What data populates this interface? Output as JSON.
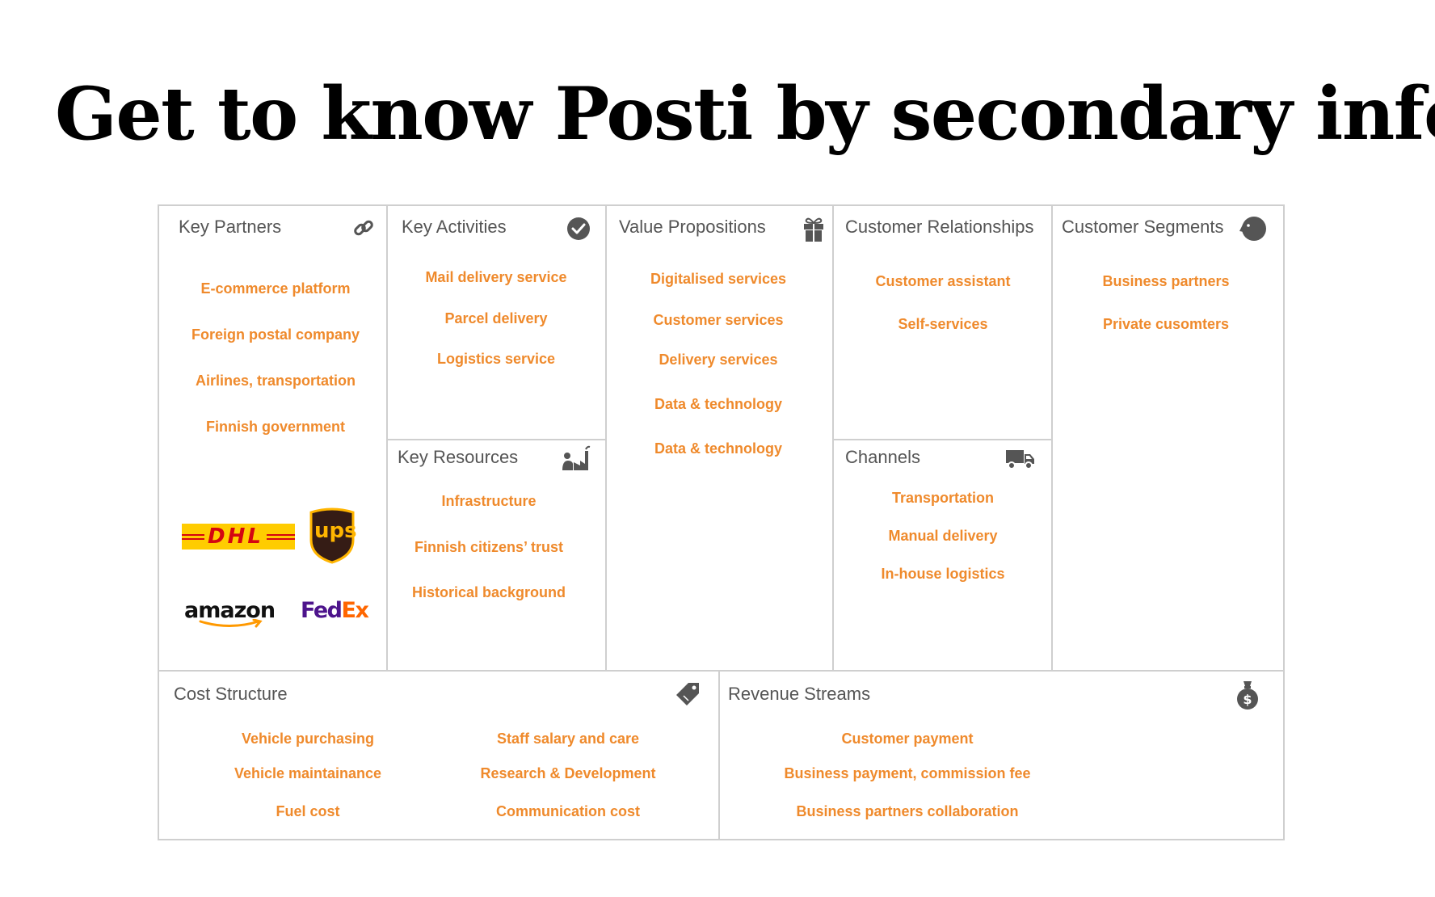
{
  "title": "Get to know Posti by secondary info",
  "colors": {
    "accent": "#ef8a2c",
    "border": "#cfcfcf",
    "heading": "#555555",
    "icon": "#555555"
  },
  "key_partners": {
    "heading": "Key Partners",
    "icon": "link-icon",
    "items": [
      "E-commerce platform",
      "Foreign postal company",
      "Airlines, transportation",
      "Finnish government"
    ],
    "logos": {
      "dhl": "DHL",
      "ups": "ups",
      "amazon": "amazon",
      "fedex_fed": "Fed",
      "fedex_ex": "Ex"
    }
  },
  "key_activities": {
    "heading": "Key Activities",
    "icon": "check-circle-icon",
    "items": [
      "Mail delivery service",
      "Parcel delivery",
      "Logistics service"
    ]
  },
  "key_resources": {
    "heading": "Key Resources",
    "icon": "factory-worker-icon",
    "items": [
      "Infrastructure",
      "Finnish citizens’ trust",
      "Historical background"
    ]
  },
  "value_propositions": {
    "heading": "Value Propositions",
    "icon": "gift-icon",
    "items": [
      "Digitalised services",
      "Customer services",
      "Delivery services",
      "Data & technology",
      "Data & technology"
    ]
  },
  "customer_relationships": {
    "heading": "Customer Relationships",
    "icon": "heart-icon",
    "items": [
      "Customer assistant",
      "Self-services"
    ]
  },
  "channels": {
    "heading": "Channels",
    "icon": "truck-icon",
    "items": [
      "Transportation",
      "Manual delivery",
      "In-house logistics"
    ]
  },
  "customer_segments": {
    "heading": "Customer Segments",
    "icon": "person-head-icon",
    "items": [
      "Business partners",
      "Private cusomters"
    ]
  },
  "cost_structure": {
    "heading": "Cost Structure",
    "icon": "price-tag-icon",
    "left_items": [
      "Vehicle purchasing",
      "Vehicle maintainance",
      "Fuel cost"
    ],
    "right_items": [
      "Staff salary and care",
      "Research & Development",
      "Communication cost"
    ]
  },
  "revenue_streams": {
    "heading": "Revenue Streams",
    "icon": "money-bag-icon",
    "items": [
      "Customer payment",
      "Business payment, commission fee",
      "Business partners collaboration"
    ]
  }
}
